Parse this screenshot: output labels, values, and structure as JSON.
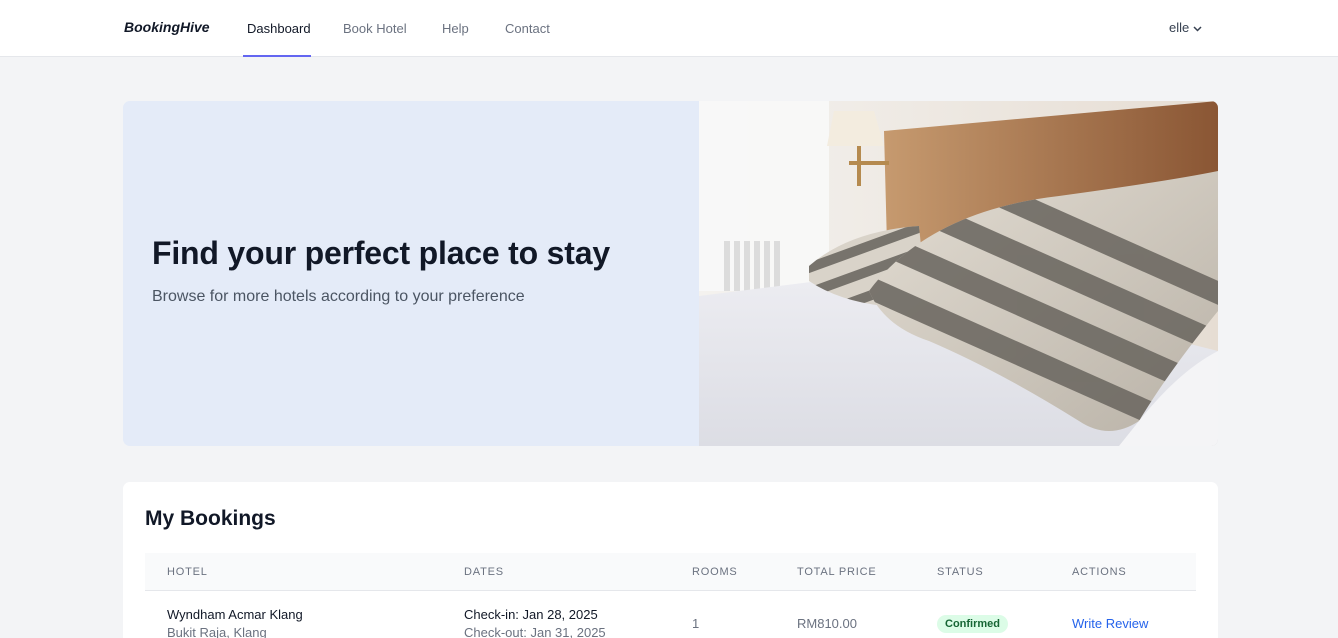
{
  "nav": {
    "brand": "BookingHive",
    "items": [
      {
        "label": "Dashboard",
        "active": true
      },
      {
        "label": "Book Hotel",
        "active": false
      },
      {
        "label": "Help",
        "active": false
      },
      {
        "label": "Contact",
        "active": false
      }
    ],
    "user": "elle",
    "accent": "#6366f1"
  },
  "hero": {
    "title": "Find your perfect place to stay",
    "subtitle": "Browse for more hotels according to your preference",
    "background": "#e4ebf8"
  },
  "bookings": {
    "title": "My Bookings",
    "columns": [
      "HOTEL",
      "DATES",
      "ROOMS",
      "TOTAL PRICE",
      "STATUS",
      "ACTIONS"
    ],
    "rows": [
      {
        "hotel": "Wyndham Acmar Klang",
        "location": "Bukit Raja, Klang",
        "check_in": "Check-in: Jan 28, 2025",
        "check_out": "Check-out: Jan 31, 2025",
        "rooms": "1",
        "total_price": "RM810.00",
        "status": "Confirmed",
        "action": "Write Review"
      }
    ]
  },
  "colors": {
    "status_confirmed_bg": "#dcfce7",
    "status_confirmed_text": "#166534",
    "link": "#2563eb"
  }
}
